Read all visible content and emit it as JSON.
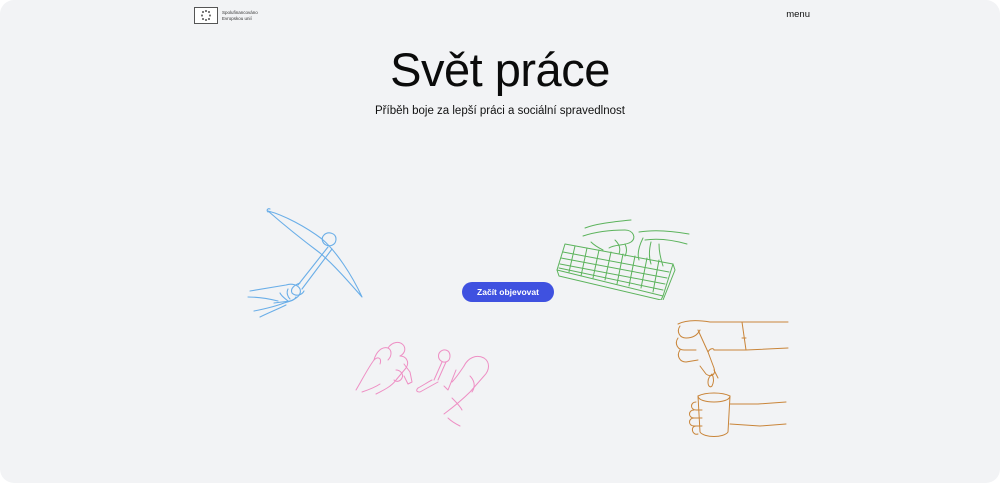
{
  "header": {
    "eu_line1": "Spolufinancováno",
    "eu_line2": "Evropskou unií",
    "menu_label": "menu"
  },
  "hero": {
    "title": "Svět práce",
    "subtitle": "Příběh boje za lepší práci a sociální spravedlnost",
    "cta_label": "Začít objevovat"
  },
  "colors": {
    "background": "#f2f3f5",
    "cta": "#3f51e0",
    "pickaxe": "#6aaee8",
    "keyboard": "#5cb35c",
    "tools": "#ee8fc4",
    "kettle": "#c9853a"
  },
  "illustrations": [
    "pickaxe-hand-icon",
    "keyboard-hands-icon",
    "tools-hands-icon",
    "pouring-cup-icon"
  ]
}
